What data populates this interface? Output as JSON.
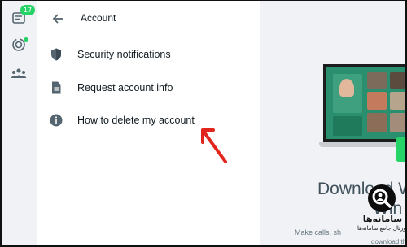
{
  "rail": {
    "chats_badge": "17"
  },
  "header": {
    "title": "Account"
  },
  "menu": [
    {
      "label": "Security notifications",
      "icon": "shield-icon"
    },
    {
      "label": "Request account info",
      "icon": "document-icon"
    },
    {
      "label": "How to delete my account",
      "icon": "info-icon"
    }
  ],
  "promo": {
    "title_line1": "Download W",
    "title_line2": "Win",
    "sub_line1": "Make calls, sh",
    "sub_line2": "download th"
  },
  "watermark": {
    "name": "سامانه‌ها",
    "tagline": "پورتال جامع سامانه‌ها"
  },
  "colors": {
    "accent": "#25d366",
    "annotation_arrow": "#e3261d",
    "screen": "#2a8f6f"
  }
}
